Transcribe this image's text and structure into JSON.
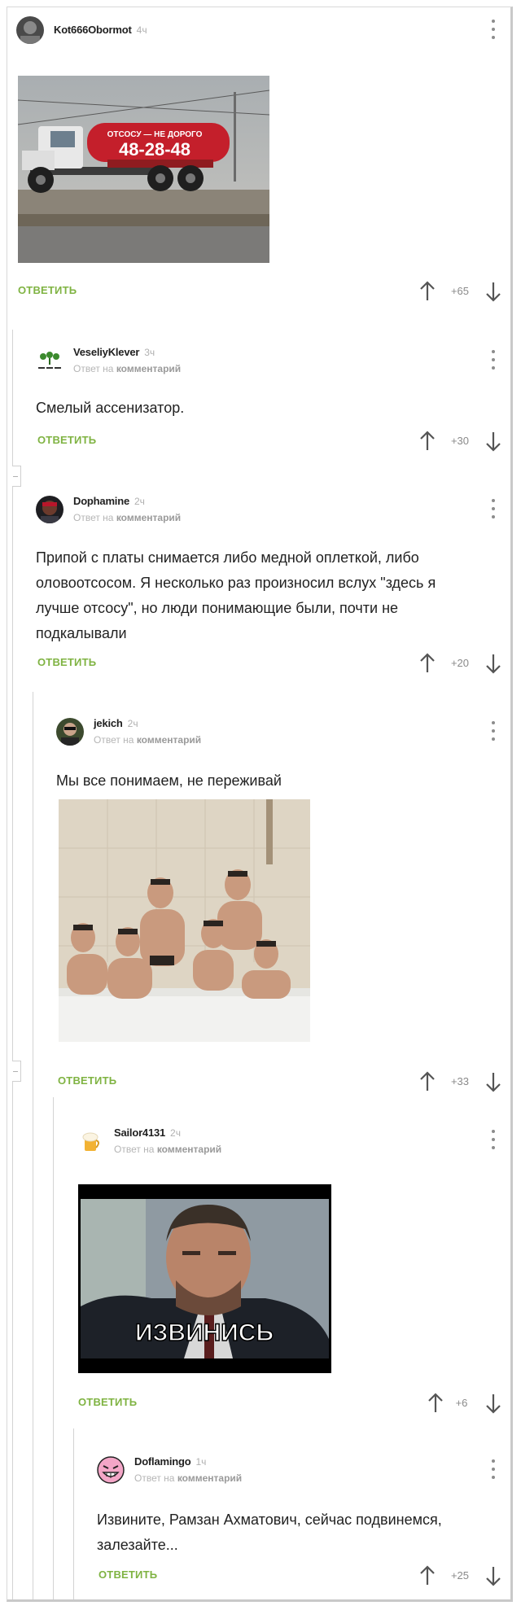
{
  "labels": {
    "reply": "ОТВЕТИТЬ",
    "reply_to_prefix": "Ответ на",
    "reply_to_target": "комментарий"
  },
  "colors": {
    "accent_green": "#7fb342",
    "meta_gray": "#b0b0b0",
    "border": "#d3d3d3"
  },
  "comments": [
    {
      "username": "Kot666Obormot",
      "time": "4ч",
      "score": "+65",
      "avatar_icon": "avatar-gray-icon",
      "image": {
        "truck_text_top": "ОТСОСУ — НЕ ДОРОГО",
        "truck_phone": "48-28-48"
      }
    },
    {
      "username": "VeseliyKlever",
      "time": "3ч",
      "score": "+30",
      "avatar_icon": "clover-avatar-icon",
      "text": "Смелый ассенизатор."
    },
    {
      "username": "Dophamine",
      "time": "2ч",
      "score": "+20",
      "avatar_icon": "dark-portrait-avatar-icon",
      "text": "Припой с платы снимается либо медной оплеткой, либо оловоотсосом. Я несколько раз произносил вслух \"здесь я лучше отсосу\", но люди понимающие были, почти не подкалывали"
    },
    {
      "username": "jekich",
      "time": "2ч",
      "score": "+33",
      "avatar_icon": "person-avatar-icon",
      "text": "Мы все понимаем, не переживай"
    },
    {
      "username": "Sailor4131",
      "time": "2ч",
      "score": "+6",
      "avatar_icon": "beer-avatar-icon",
      "image": {
        "caption": "ИЗВИНИСЬ"
      }
    },
    {
      "username": "Doflamingo",
      "time": "1ч",
      "score": "+25",
      "avatar_icon": "pink-grin-avatar-icon",
      "text": "Извините, Рамзан Ахматович, сейчас подвинемся, залезайте..."
    }
  ]
}
